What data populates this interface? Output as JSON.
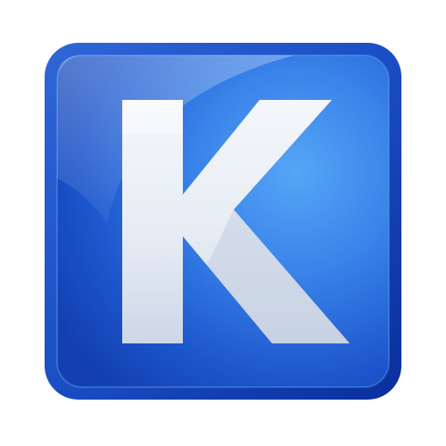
{
  "icon": {
    "letter": "K",
    "colors": {
      "frame_dark": "#0a2e9c",
      "frame_light": "#3f78e0",
      "face_top": "#3a8df0",
      "face_bottom": "#1549c4",
      "letter_light": "#f2f5fa",
      "letter_shade": "#c9d3e4"
    }
  }
}
